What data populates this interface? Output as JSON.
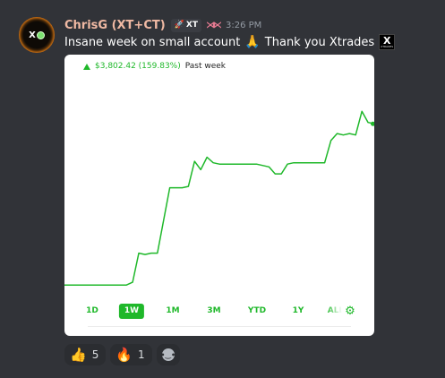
{
  "message": {
    "author": "ChrisG (XT+CT)",
    "avatar_icon": "xtrades-logo-avatar",
    "role_tag": "XT",
    "role_tag_icon": "rocket-icon",
    "badge_icon": "ar-logo-icon",
    "badge_text": "⋊⋉",
    "timestamp": "3:26 PM",
    "text": "Insane week on small account",
    "pray_emoji": "🙏",
    "text_after": "Thank you Xtrades",
    "xtrades_emoji_x": "X",
    "xtrades_emoji_label": "XTRADES"
  },
  "portfolio_card": {
    "gain_value": "$3,802.42 (159.83%)",
    "gain_period": "Past week",
    "gain_color": "#1fb82a",
    "ranges": [
      "1D",
      "1W",
      "1M",
      "3M",
      "YTD",
      "1Y",
      "ALL"
    ],
    "active_range": "1W",
    "settings_icon": "gear-icon",
    "settings_glyph": "⚙"
  },
  "chart_data": {
    "type": "line",
    "title": "",
    "xlabel": "",
    "ylabel": "",
    "color": "#1fb82a",
    "x": [
      0,
      5,
      10,
      15,
      20,
      22,
      24,
      26,
      28,
      30,
      34,
      38,
      40,
      42,
      44,
      46,
      48,
      50,
      54,
      58,
      62,
      66,
      68,
      70,
      72,
      74,
      76,
      80,
      84,
      86,
      88,
      90,
      92,
      94,
      96,
      98,
      100
    ],
    "values": [
      0,
      0,
      0,
      0,
      0,
      2,
      23,
      22,
      23,
      23,
      70,
      70,
      71,
      89,
      83,
      92,
      88,
      87,
      87,
      87,
      87,
      85,
      80,
      80,
      87,
      88,
      88,
      88,
      88,
      104,
      109,
      108,
      109,
      108,
      125,
      117,
      116,
      118
    ],
    "ylim": [
      -5,
      140
    ],
    "xlim": [
      0,
      100
    ]
  },
  "reactions": [
    {
      "emoji": "👍",
      "count": "5",
      "name": "thumbs-up"
    },
    {
      "emoji": "🔥",
      "count": "1",
      "name": "fire"
    }
  ],
  "add_reaction_icon": "add-reaction-icon",
  "add_reaction_glyph": "•‿•"
}
